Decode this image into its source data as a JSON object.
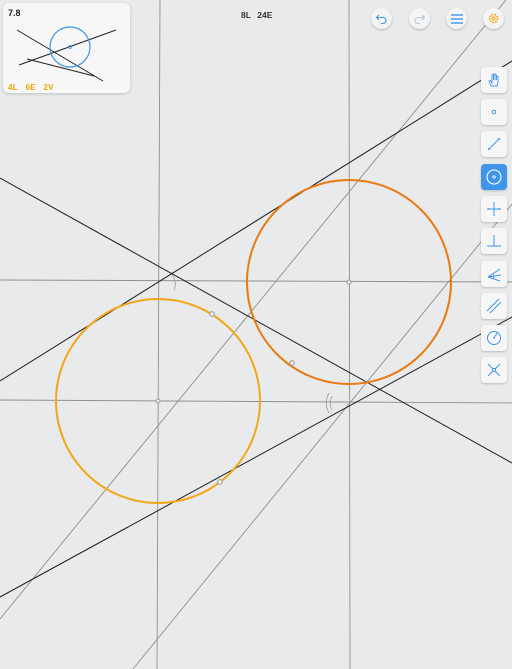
{
  "level": {
    "number": "7.8"
  },
  "goals": {
    "lines": "4L",
    "euclid": "6E",
    "verbs": "2V"
  },
  "moves": {
    "lines": "8L",
    "euclid": "24E"
  },
  "colors": {
    "background": "#e9eaeb",
    "given_line": "#1f1f1f",
    "constructed_line": "#8c8c8c",
    "orange_circle": "#ea7a12",
    "yellow_circle": "#f2a71b",
    "accent": "#3f95ea",
    "goal_text": "#f0a400"
  },
  "top_buttons": [
    {
      "name": "undo-icon",
      "enabled": true
    },
    {
      "name": "redo-icon",
      "enabled": false
    },
    {
      "name": "menu-icon",
      "enabled": true
    },
    {
      "name": "settings-icon",
      "enabled": true
    }
  ],
  "tools": [
    {
      "name": "hand-move-tool",
      "icon": "hand-icon",
      "active": false
    },
    {
      "name": "point-tool",
      "icon": "point-icon",
      "active": false
    },
    {
      "name": "line-tool",
      "icon": "line-icon",
      "active": false
    },
    {
      "name": "circle-tool",
      "icon": "circle-icon",
      "active": true
    },
    {
      "name": "perpendicular-bisector-tool",
      "icon": "perpendicular-bisector-icon",
      "active": false
    },
    {
      "name": "perpendicular-tool",
      "icon": "perpendicular-icon",
      "active": false
    },
    {
      "name": "angle-bisector-tool",
      "icon": "angle-bisector-icon",
      "active": false
    },
    {
      "name": "parallel-tool",
      "icon": "parallel-icon",
      "active": false
    },
    {
      "name": "compass-tool",
      "icon": "compass-icon",
      "active": false
    },
    {
      "name": "intersect-tool",
      "icon": "intersect-icon",
      "active": false
    }
  ]
}
